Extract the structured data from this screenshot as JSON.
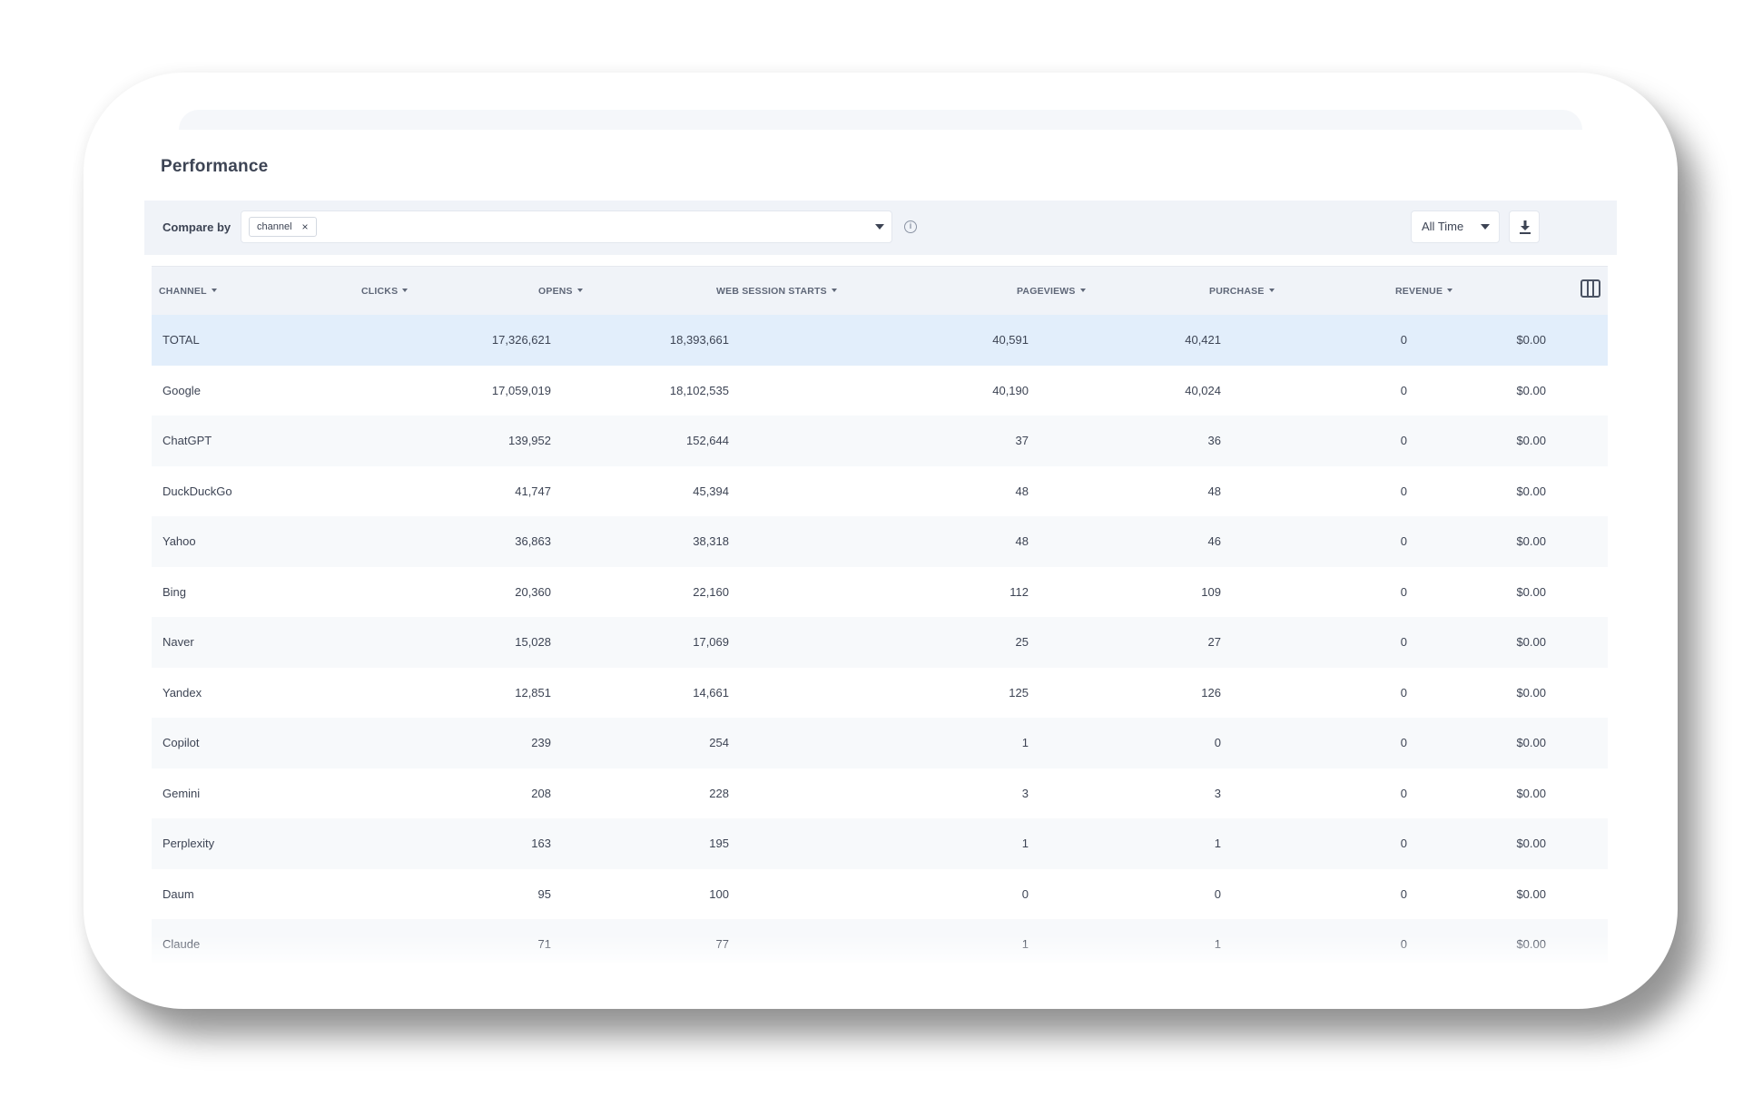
{
  "page": {
    "title": "Performance"
  },
  "compare": {
    "label": "Compare by",
    "chip": "channel",
    "chip_remove": "×",
    "info": "i"
  },
  "time_range": {
    "value": "All Time"
  },
  "table": {
    "columns": [
      "CHANNEL",
      "CLICKS",
      "OPENS",
      "WEB SESSION STARTS",
      "PAGEVIEWS",
      "PURCHASE",
      "REVENUE"
    ],
    "rows": [
      {
        "channel": "TOTAL",
        "clicks": "17,326,621",
        "opens": "18,393,661",
        "web_session_starts": "40,591",
        "pageviews": "40,421",
        "purchase": "0",
        "revenue": "$0.00"
      },
      {
        "channel": "Google",
        "clicks": "17,059,019",
        "opens": "18,102,535",
        "web_session_starts": "40,190",
        "pageviews": "40,024",
        "purchase": "0",
        "revenue": "$0.00"
      },
      {
        "channel": "ChatGPT",
        "clicks": "139,952",
        "opens": "152,644",
        "web_session_starts": "37",
        "pageviews": "36",
        "purchase": "0",
        "revenue": "$0.00"
      },
      {
        "channel": "DuckDuckGo",
        "clicks": "41,747",
        "opens": "45,394",
        "web_session_starts": "48",
        "pageviews": "48",
        "purchase": "0",
        "revenue": "$0.00"
      },
      {
        "channel": "Yahoo",
        "clicks": "36,863",
        "opens": "38,318",
        "web_session_starts": "48",
        "pageviews": "46",
        "purchase": "0",
        "revenue": "$0.00"
      },
      {
        "channel": "Bing",
        "clicks": "20,360",
        "opens": "22,160",
        "web_session_starts": "112",
        "pageviews": "109",
        "purchase": "0",
        "revenue": "$0.00"
      },
      {
        "channel": "Naver",
        "clicks": "15,028",
        "opens": "17,069",
        "web_session_starts": "25",
        "pageviews": "27",
        "purchase": "0",
        "revenue": "$0.00"
      },
      {
        "channel": "Yandex",
        "clicks": "12,851",
        "opens": "14,661",
        "web_session_starts": "125",
        "pageviews": "126",
        "purchase": "0",
        "revenue": "$0.00"
      },
      {
        "channel": "Copilot",
        "clicks": "239",
        "opens": "254",
        "web_session_starts": "1",
        "pageviews": "0",
        "purchase": "0",
        "revenue": "$0.00"
      },
      {
        "channel": "Gemini",
        "clicks": "208",
        "opens": "228",
        "web_session_starts": "3",
        "pageviews": "3",
        "purchase": "0",
        "revenue": "$0.00"
      },
      {
        "channel": "Perplexity",
        "clicks": "163",
        "opens": "195",
        "web_session_starts": "1",
        "pageviews": "1",
        "purchase": "0",
        "revenue": "$0.00"
      },
      {
        "channel": "Daum",
        "clicks": "95",
        "opens": "100",
        "web_session_starts": "0",
        "pageviews": "0",
        "purchase": "0",
        "revenue": "$0.00"
      },
      {
        "channel": "Claude",
        "clicks": "71",
        "opens": "77",
        "web_session_starts": "1",
        "pageviews": "1",
        "purchase": "0",
        "revenue": "$0.00"
      }
    ]
  },
  "icons": {
    "download": "download-icon",
    "columns": "columns-icon",
    "sort": "sort-caret-icon"
  },
  "colors": {
    "total_row": "#e2eefb",
    "header_bg": "#f0f3f8",
    "text": "#3d4454"
  }
}
